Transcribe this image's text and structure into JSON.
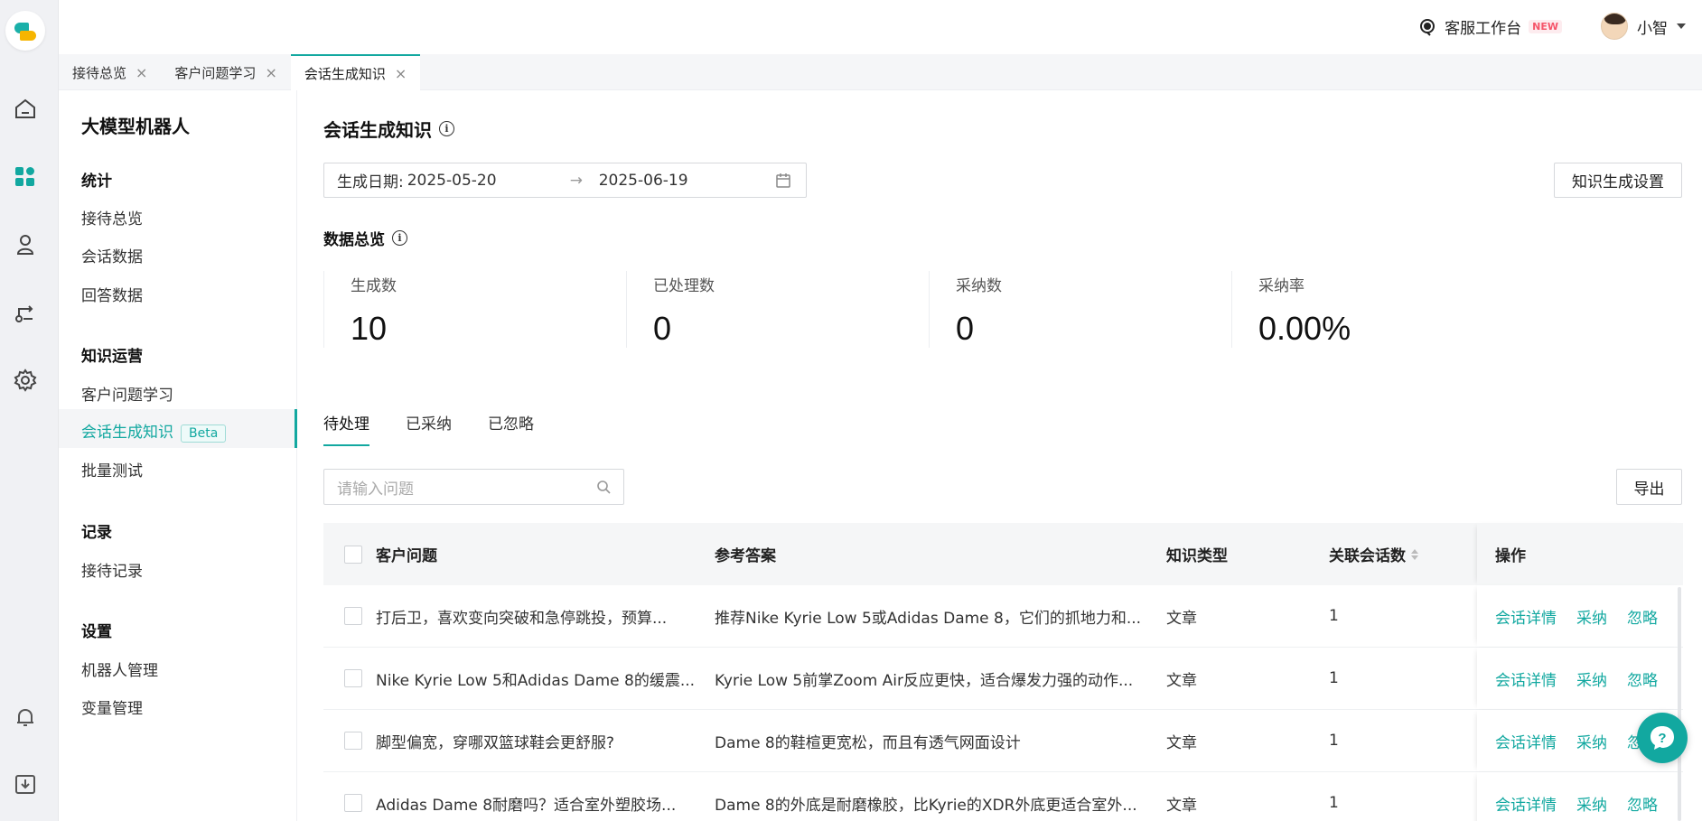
{
  "topbar": {
    "workspace_label": "客服工作台",
    "new_badge": "NEW",
    "user_name": "小智"
  },
  "tabs": [
    {
      "label": "接待总览",
      "close": "×"
    },
    {
      "label": "客户问题学习",
      "close": "×"
    },
    {
      "label": "会话生成知识",
      "close": "×"
    }
  ],
  "sidebar": {
    "title": "大模型机器人",
    "groups": [
      {
        "label": "统计",
        "items": [
          "接待总览",
          "会话数据",
          "回答数据"
        ]
      },
      {
        "label": "知识运营",
        "items": [
          "客户问题学习",
          "会话生成知识",
          "批量测试"
        ]
      },
      {
        "label": "记录",
        "items": [
          "接待记录"
        ]
      },
      {
        "label": "设置",
        "items": [
          "机器人管理",
          "变量管理"
        ]
      }
    ],
    "beta_badge": "Beta"
  },
  "main": {
    "title": "会话生成知识",
    "date_label": "生成日期:",
    "date_start": "2025-05-20",
    "date_arrow": "→",
    "date_end": "2025-06-19",
    "settings_button": "知识生成设置",
    "overview_title": "数据总览",
    "stats": [
      {
        "label": "生成数",
        "value": "10"
      },
      {
        "label": "已处理数",
        "value": "0"
      },
      {
        "label": "采纳数",
        "value": "0"
      },
      {
        "label": "采纳率",
        "value": "0.00%"
      }
    ],
    "content_tabs": [
      "待处理",
      "已采纳",
      "已忽略"
    ],
    "search_placeholder": "请输入问题",
    "export_button": "导出",
    "table": {
      "headers": [
        "客户问题",
        "参考答案",
        "知识类型",
        "关联会话数",
        "操作"
      ],
      "rows": [
        {
          "q": "打后卫，喜欢变向突破和急停跳投，预算...",
          "a": "推荐Nike Kyrie Low 5或Adidas Dame 8，它们的抓地力和...",
          "type": "文章",
          "count": "1"
        },
        {
          "q": "Nike Kyrie Low 5和Adidas Dame 8的缓震...",
          "a": "Kyrie Low 5前掌Zoom Air反应更快，适合爆发力强的动作...",
          "type": "文章",
          "count": "1"
        },
        {
          "q": "脚型偏宽，穿哪双篮球鞋会更舒服?",
          "a": "Dame 8的鞋楦更宽松，而且有透气网面设计",
          "type": "文章",
          "count": "1"
        },
        {
          "q": "Adidas Dame 8耐磨吗？适合室外塑胶场...",
          "a": "Dame 8的外底是耐磨橡胶，比Kyrie的XDR外底更适合室外...",
          "type": "文章",
          "count": "1"
        }
      ],
      "actions": [
        "会话详情",
        "采纳",
        "忽略"
      ]
    }
  },
  "colors": {
    "accent": "#12a8a0",
    "new_badge": "#f5556a"
  }
}
